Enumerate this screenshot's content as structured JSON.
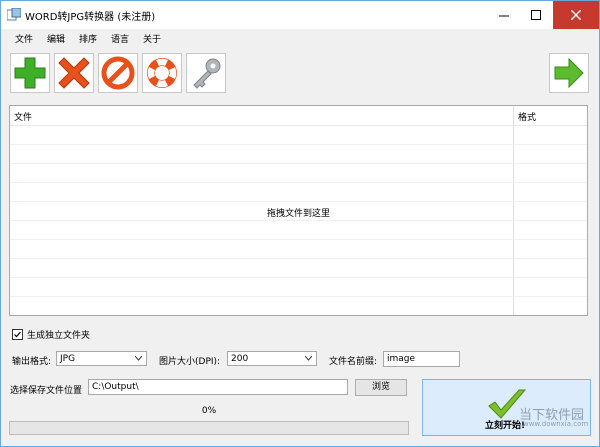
{
  "window": {
    "title": "WORD转JPG转换器 (未注册)"
  },
  "menu": {
    "items": [
      "文件",
      "编辑",
      "排序",
      "语言",
      "关于"
    ]
  },
  "toolbar": {
    "buttons": [
      {
        "icon": "add-icon",
        "color": "#3fae29"
      },
      {
        "icon": "delete-icon",
        "color": "#e8501c"
      },
      {
        "icon": "clear-icon",
        "color": "#e8501c"
      },
      {
        "icon": "help-lifebuoy-icon",
        "color": "#e8501c"
      },
      {
        "icon": "key-icon",
        "color": "#9aa0a6"
      }
    ],
    "next_icon": "arrow-right-icon"
  },
  "file_list": {
    "col_file": "文件",
    "col_format": "格式",
    "drop_hint": "拖拽文件到这里"
  },
  "options": {
    "separate_folder_label": "生成独立文件夹",
    "separate_folder_checked": true,
    "output_format_label": "输出格式:",
    "output_format_value": "JPG",
    "dpi_label": "图片大小(DPI):",
    "dpi_value": "200",
    "prefix_label": "文件名前缀:",
    "prefix_value": "image"
  },
  "output": {
    "location_label": "选择保存文件位置",
    "path_value": "C:\\Output\\",
    "browse_label": "浏览"
  },
  "progress": {
    "label": "0%",
    "fraction": 0
  },
  "start_button": {
    "label": "立刻开始!"
  },
  "watermark": {
    "text": "当下软件园",
    "sub": "www.downxia.com"
  },
  "colors": {
    "accent": "#3fae29",
    "close": "#c7392f",
    "start_bg": "#dcecfc"
  }
}
